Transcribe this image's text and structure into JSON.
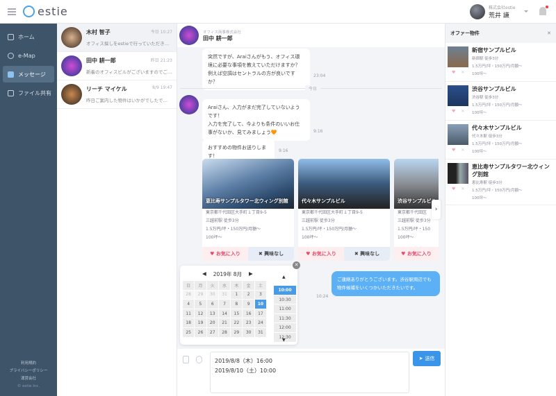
{
  "header": {
    "logo": "estie",
    "user_company": "株式会社estie",
    "user_name": "荒井 謙"
  },
  "sidebar": {
    "items": [
      {
        "label": "ホーム",
        "icon": "home-icon"
      },
      {
        "label": "e-Map",
        "icon": "map-pin-icon"
      },
      {
        "label": "メッセージ",
        "icon": "chat-icon",
        "active": true
      },
      {
        "label": "ファイル共有",
        "icon": "file-share-icon"
      }
    ],
    "footer": [
      "利用規約",
      "プライバシーポリシー",
      "運営会社",
      "© estie Inc."
    ]
  },
  "conversations": [
    {
      "name": "木村 智子",
      "time": "今日 10:27",
      "preview": "オフィス探しをestieで行っていただき…"
    },
    {
      "name": "田中 耕一郎",
      "time": "昨日 21:23",
      "preview": "新着のオフィスビルがございますのでご…"
    },
    {
      "name": "リーチ マイケル",
      "time": "8/9 19:47",
      "preview": "昨日ご案内した物件はいかがでしたで…"
    }
  ],
  "chat": {
    "company": "オフィス商事株式会社",
    "name": "田中 耕一郎",
    "msg1": "突然ですが、Araiさんがもう、オフィス環境に必要な事項を教えていただけますか？例えば空調はセントラルの方が良いですか？",
    "msg1_time": "23:04",
    "divider": "今日",
    "msg2": "Araiさん、入力がまだ完了していないようです！\n入力を完了して、今よりも条件のいいお仕事がないか、見てみましょう🧡",
    "msg2_time": "9:16",
    "msg3": "おすすめの物件お送りします！",
    "msg3_time": "9:16",
    "cards": [
      {
        "title": "恵比寿サンプルタワー北ウィング別館",
        "address": "東京都千代田区大手町１丁目9-5",
        "station": "三越前駅 徒歩3分",
        "price": "1.5万円/坪・150万円/月額〜",
        "area": "100坪〜"
      },
      {
        "title": "代々木サンプルビル",
        "address": "東京都千代田区大手町１丁目9-5",
        "station": "三越前駅 徒歩3分",
        "price": "1.5万円/坪・150万円/月額〜",
        "area": "100坪〜"
      },
      {
        "title": "渋谷サンプルビル",
        "address": "東京都千代田区",
        "station": "三越前駅 徒歩3分",
        "price": "1.5万円/坪・150",
        "area": "100坪〜"
      }
    ],
    "like_label": "お気に入り",
    "dislike_label": "興味なし",
    "my_msg": "ご連絡ありがとうございます。渋谷駅周辺でも物件候補をいくつかいただきたいです。",
    "my_msg_time": "10:24"
  },
  "picker": {
    "month": "2019年 8月",
    "weekdays": [
      "日",
      "月",
      "火",
      "水",
      "木",
      "金",
      "土"
    ],
    "weeks": [
      [
        "28",
        "29",
        "30",
        "31",
        "1",
        "2",
        "3"
      ],
      [
        "4",
        "5",
        "6",
        "7",
        "8",
        "9",
        "10"
      ],
      [
        "11",
        "12",
        "13",
        "14",
        "15",
        "16",
        "17"
      ],
      [
        "18",
        "19",
        "20",
        "21",
        "22",
        "23",
        "24"
      ],
      [
        "25",
        "26",
        "27",
        "28",
        "29",
        "30",
        "31"
      ]
    ],
    "selected_day": "10",
    "times": [
      "10:00",
      "10:30",
      "11:00",
      "11:30",
      "12:00",
      "12:30"
    ],
    "selected_time": "10:00"
  },
  "composer": {
    "lines": [
      "2019/8/8（木）16:00",
      "2019/8/10（土）10:00"
    ],
    "send_label": "送信"
  },
  "offers": {
    "title": "オファー物件",
    "items": [
      {
        "name": "新宿サンプルビル",
        "station": "新宿駅 徒歩3分",
        "price": "1.5万円/坪・150万円/月額〜",
        "area": "100坪〜"
      },
      {
        "name": "渋谷サンプルビル",
        "station": "渋谷駅 徒歩3分",
        "price": "1.5万円/坪・150万円/月額〜",
        "area": "100坪〜"
      },
      {
        "name": "代々木サンプルビル",
        "station": "代々木駅 徒歩3分",
        "price": "1.5万円/坪・150万円/月額〜",
        "area": "100坪〜"
      },
      {
        "name": "恵比寿サンプルタワー北ウィング別館",
        "station": "恵比寿駅 徒歩3分",
        "price": "1.5万円/坪・150万円/月額〜",
        "area": "100坪〜"
      }
    ]
  },
  "colors": {
    "sidebar": "#3e5569",
    "accent": "#3a94e8",
    "like": "#e84a6a"
  }
}
